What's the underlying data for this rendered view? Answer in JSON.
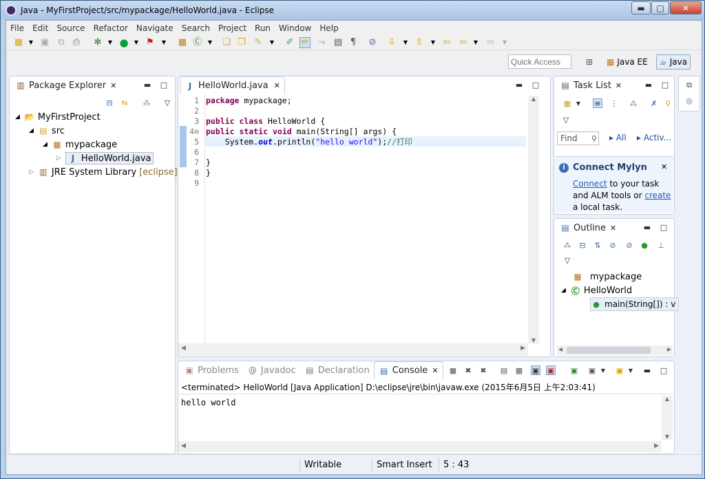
{
  "window": {
    "title": "Java - MyFirstProject/src/mypackage/HelloWorld.java - Eclipse",
    "min_glyph": "▬",
    "max_glyph": "□",
    "close_glyph": "✕"
  },
  "menu": [
    "File",
    "Edit",
    "Source",
    "Refactor",
    "Navigate",
    "Search",
    "Project",
    "Run",
    "Window",
    "Help"
  ],
  "quick_access": {
    "placeholder": "Quick Access"
  },
  "perspectives": [
    {
      "label": "Java EE"
    },
    {
      "label": "Java"
    }
  ],
  "package_explorer": {
    "tab_label": "Package Explorer",
    "tree": {
      "project": "MyFirstProject",
      "src": "src",
      "package": "mypackage",
      "file": "HelloWorld.java",
      "jre": "JRE System Library",
      "jre_suffix": "[eclipse]"
    }
  },
  "editor": {
    "tab_label": "HelloWorld.java",
    "lines": [
      {
        "n": "1",
        "segments": [
          {
            "t": "package",
            "c": "kw"
          },
          {
            "t": " mypackage;",
            "c": ""
          }
        ]
      },
      {
        "n": "2",
        "segments": []
      },
      {
        "n": "3",
        "segments": [
          {
            "t": "public",
            "c": "kw"
          },
          {
            "t": " ",
            "c": ""
          },
          {
            "t": "class",
            "c": "kw"
          },
          {
            "t": " HelloWorld {",
            "c": ""
          }
        ]
      },
      {
        "n": "4⊖",
        "segments": [
          {
            "t": "public",
            "c": "kw"
          },
          {
            "t": " ",
            "c": ""
          },
          {
            "t": "static",
            "c": "kw"
          },
          {
            "t": " ",
            "c": ""
          },
          {
            "t": "void",
            "c": "kw"
          },
          {
            "t": " main(String[] args) {",
            "c": ""
          }
        ]
      },
      {
        "n": "5",
        "segments": [
          {
            "t": "    System.",
            "c": ""
          },
          {
            "t": "out",
            "c": "fld"
          },
          {
            "t": ".println(",
            "c": ""
          },
          {
            "t": "\"hello world\"",
            "c": "str"
          },
          {
            "t": ");",
            "c": ""
          },
          {
            "t": "//打印",
            "c": "cmt"
          }
        ]
      },
      {
        "n": "6",
        "segments": []
      },
      {
        "n": "7",
        "segments": [
          {
            "t": "}",
            "c": ""
          }
        ]
      },
      {
        "n": "8",
        "segments": [
          {
            "t": "}",
            "c": ""
          }
        ]
      },
      {
        "n": "9",
        "segments": []
      }
    ]
  },
  "task_list": {
    "tab_label": "Task List",
    "find_placeholder": "Find",
    "all_label": "All",
    "activ_label": "Activ..."
  },
  "mylyn": {
    "title": "Connect Mylyn",
    "connect": "Connect",
    "text1": " to your task",
    "text2": "and ALM tools or ",
    "create": "create",
    "text3": "a local task."
  },
  "outline": {
    "tab_label": "Outline",
    "items": {
      "package": "mypackage",
      "class": "HelloWorld",
      "method": "main(String[]) : v"
    }
  },
  "bottom_tabs": [
    {
      "label": "Problems",
      "active": false
    },
    {
      "label": "Javadoc",
      "active": false
    },
    {
      "label": "Declaration",
      "active": false
    },
    {
      "label": "Console",
      "active": true
    }
  ],
  "console": {
    "header": "<terminated> HelloWorld [Java Application] D:\\eclipse\\jre\\bin\\javaw.exe (2015年6月5日 上午2:03:41)",
    "output": "hello world"
  },
  "status": {
    "writable": "Writable",
    "insert_mode": "Smart Insert",
    "position": "5 : 43"
  }
}
